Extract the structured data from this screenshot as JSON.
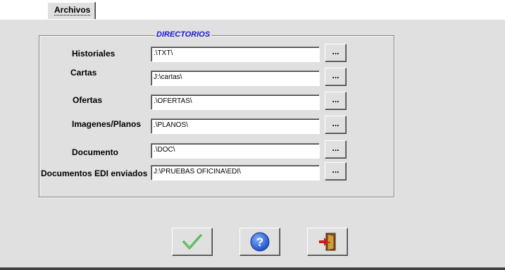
{
  "tabs": [
    {
      "label": "Archivos",
      "active": true
    }
  ],
  "group": {
    "title": "DIRECTORIOS"
  },
  "rows": [
    {
      "label": "Historiales",
      "value": ".\\TXT\\",
      "browse_label": "..."
    },
    {
      "label": "Cartas",
      "value": "J:\\cartas\\",
      "browse_label": "..."
    },
    {
      "label": "Ofertas",
      "value": ".\\OFERTAS\\",
      "browse_label": "..."
    },
    {
      "label": "Imagenes/Planos",
      "value": ".\\PLANOS\\",
      "browse_label": "..."
    },
    {
      "label": "Documento",
      "value": ".\\DOC\\",
      "browse_label": "..."
    },
    {
      "label": "Documentos EDI enviados",
      "value": "J:\\PRUEBAS OFICINA\\EDI\\",
      "browse_label": "..."
    }
  ],
  "buttons": {
    "accept_icon": "checkmark-icon",
    "help_icon": "help-question-icon",
    "exit_icon": "exit-door-icon"
  },
  "colors": {
    "panel_bg": "#e0e0e0",
    "group_title": "#1a1ad0",
    "checkmark": "#2fa52f",
    "help_blue": "#1f4fc8",
    "exit_door": "#c87a1e",
    "exit_arrow": "#d01818"
  }
}
